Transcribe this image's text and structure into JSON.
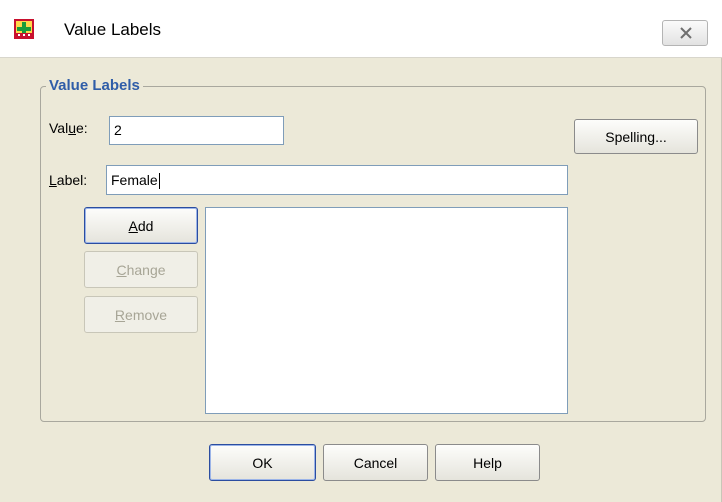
{
  "window": {
    "title": "Value Labels",
    "close_label": "Close"
  },
  "group": {
    "legend": "Value Labels"
  },
  "value_field": {
    "label_mnemonic": "Val",
    "label_mnemonic_char": "u",
    "label_rest": "e:",
    "value": "2"
  },
  "label_field": {
    "label_mnemonic_char": "L",
    "label_rest": "abel:",
    "value": "Female"
  },
  "buttons": {
    "spelling": "Spelling...",
    "add_char": "A",
    "add_rest": "dd",
    "change_char": "C",
    "change_rest": "hange",
    "remove_char": "R",
    "remove_rest": "emove",
    "ok": "OK",
    "cancel": "Cancel",
    "help": "Help"
  },
  "value_list": {
    "items": []
  },
  "colors": {
    "dialog_bg": "#ece9d8",
    "legend_text": "#2f5da8",
    "field_border": "#7f9db9"
  }
}
